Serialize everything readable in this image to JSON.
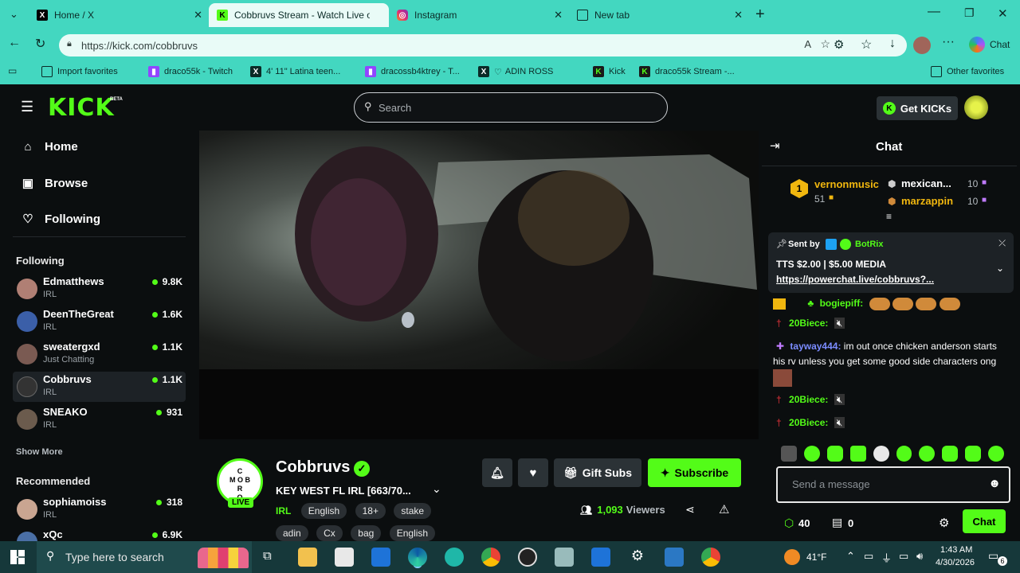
{
  "browser": {
    "tabs": [
      {
        "title": "Home / X",
        "icon": "x-logo-icon"
      },
      {
        "title": "Cobbruvs Stream - Watch Live on K",
        "icon": "kick-logo-icon",
        "active": true
      },
      {
        "title": "Instagram",
        "icon": "instagram-icon"
      },
      {
        "title": "New tab",
        "icon": "new-tab-icon"
      }
    ],
    "url": "https://kick.com/cobbruvs",
    "chat_label": "Chat",
    "bookmarks": [
      "Import favorites",
      "draco55k - Twitch",
      "4' 11\" Latina teen...",
      "dracossb4ktrey - T...",
      "ADIN ROSS",
      "Kick",
      "draco55k Stream -..."
    ],
    "other_favorites": "Other favorites"
  },
  "site": {
    "logo": "KICK",
    "logo_badge": "BETA",
    "search_placeholder": "Search",
    "get_kicks": "Get KICKs"
  },
  "sidebar": {
    "nav": [
      {
        "label": "Home",
        "icon": "home-icon"
      },
      {
        "label": "Browse",
        "icon": "browse-icon"
      },
      {
        "label": "Following",
        "icon": "heart-icon"
      }
    ],
    "following_header": "Following",
    "following": [
      {
        "name": "Edmatthews",
        "category": "IRL",
        "viewers": "9.8K",
        "color": "#b07f74"
      },
      {
        "name": "DeenTheGreat",
        "category": "IRL",
        "viewers": "1.6K",
        "color": "#3b5fa8"
      },
      {
        "name": "sweatergxd",
        "category": "Just Chatting",
        "viewers": "1.1K",
        "color": "#7a5a52"
      },
      {
        "name": "Cobbruvs",
        "category": "IRL",
        "viewers": "1.1K",
        "color": "#333"
      },
      {
        "name": "SNEAKO",
        "category": "IRL",
        "viewers": "931",
        "color": "#6b5b4d"
      }
    ],
    "show_more": "Show More",
    "recommended_header": "Recommended",
    "recommended": [
      {
        "name": "sophiamoiss",
        "category": "IRL",
        "viewers": "318",
        "color": "#c9a591"
      },
      {
        "name": "xQc",
        "category": "",
        "viewers": "6.9K",
        "color": "#4a6fa5"
      }
    ]
  },
  "stream": {
    "channel": "Cobbruvs",
    "title": "KEY WEST FL IRL [663/70...",
    "live_label": "LIVE",
    "category": "IRL",
    "tags": [
      "English",
      "18+",
      "stake",
      "adin",
      "Cx",
      "bag",
      "English"
    ],
    "gift_subs": "Gift Subs",
    "subscribe": "Subscribe",
    "viewers": "1,093",
    "viewers_label": "Viewers",
    "avatar_text": "C\nMOB\nR\nO"
  },
  "chat": {
    "header": "Chat",
    "leaderboard": [
      {
        "rank": "1",
        "name": "vernonmusic",
        "count": "51"
      },
      {
        "name": "mexican...",
        "count": "10"
      },
      {
        "name": "marzappin",
        "count": "10"
      }
    ],
    "pinned": {
      "sent_by": "Sent by",
      "bot": "BotRix",
      "line1": "TTS $2.00 | $5.00 MEDIA",
      "link": "https://powerchat.live/cobbruvs?..."
    },
    "messages": [
      {
        "user": "bogiepiff:",
        "text": "",
        "color": "#53fc18"
      },
      {
        "user": "20Biece:",
        "text": "",
        "color": "#53fc18"
      },
      {
        "user": "tayway444:",
        "text": "im out once chicken anderson starts his rv unless you get some good side characters ong",
        "color": "#7b8cff"
      },
      {
        "user": "20Biece:",
        "text": "",
        "color": "#53fc18"
      },
      {
        "user": "20Biece:",
        "text": "",
        "color": "#53fc18"
      }
    ],
    "input_placeholder": "Send a message",
    "kicks_count": "40",
    "gift_count": "0",
    "send_label": "Chat"
  },
  "taskbar": {
    "search_placeholder": "Type here to search",
    "weather": "41°F",
    "time": "1:43 AM",
    "date": "4/30/2026",
    "notifications": "6"
  }
}
